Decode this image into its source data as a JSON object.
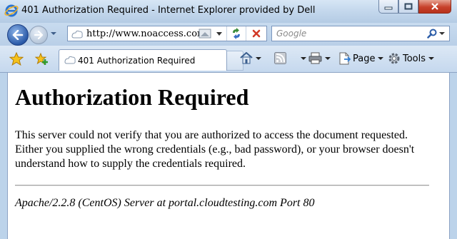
{
  "window": {
    "title": "401 Authorization Required - Internet Explorer provided by Dell"
  },
  "address_bar": {
    "url": "http://www.noaccess.com"
  },
  "search": {
    "placeholder": "Google"
  },
  "tab": {
    "label": "401 Authorization Required"
  },
  "commands": {
    "page_label": "Page",
    "tools_label": "Tools"
  },
  "page": {
    "heading": "Authorization Required",
    "body": "This server could not verify that you are authorized to access the document requested. Either you supplied the wrong credentials (e.g., bad password), or your browser doesn't understand how to supply the credentials required.",
    "server_signature": "Apache/2.2.8 (CentOS) Server at portal.cloudtesting.com Port 80"
  },
  "icons": {
    "titlebar": "internet-explorer-icon",
    "nav": [
      "back-arrow-icon",
      "forward-arrow-icon",
      "page-icon",
      "compatibility-view-icon",
      "refresh-icon",
      "stop-icon",
      "search-magnifier-icon"
    ],
    "toolbar": [
      "favorites-star-icon",
      "add-favorites-icon",
      "home-icon",
      "feeds-icon",
      "print-icon",
      "page-icon",
      "tools-gear-icon"
    ]
  },
  "colors": {
    "frame": "#bcd3ea",
    "close_button": "#c7412b",
    "stop_icon": "#d23a28"
  }
}
